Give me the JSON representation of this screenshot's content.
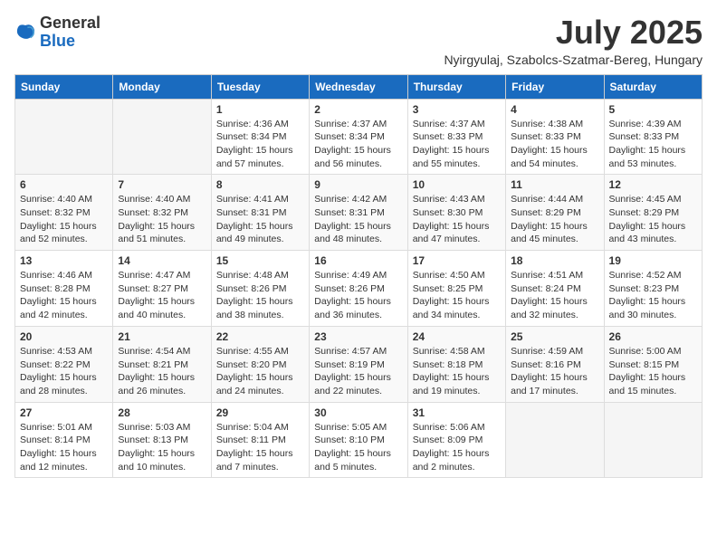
{
  "logo": {
    "general": "General",
    "blue": "Blue"
  },
  "header": {
    "month": "July 2025",
    "location": "Nyirgyulaj, Szabolcs-Szatmar-Bereg, Hungary"
  },
  "columns": [
    "Sunday",
    "Monday",
    "Tuesday",
    "Wednesday",
    "Thursday",
    "Friday",
    "Saturday"
  ],
  "weeks": [
    [
      {
        "day": "",
        "sunrise": "",
        "sunset": "",
        "daylight": ""
      },
      {
        "day": "",
        "sunrise": "",
        "sunset": "",
        "daylight": ""
      },
      {
        "day": "1",
        "sunrise": "Sunrise: 4:36 AM",
        "sunset": "Sunset: 8:34 PM",
        "daylight": "Daylight: 15 hours and 57 minutes."
      },
      {
        "day": "2",
        "sunrise": "Sunrise: 4:37 AM",
        "sunset": "Sunset: 8:34 PM",
        "daylight": "Daylight: 15 hours and 56 minutes."
      },
      {
        "day": "3",
        "sunrise": "Sunrise: 4:37 AM",
        "sunset": "Sunset: 8:33 PM",
        "daylight": "Daylight: 15 hours and 55 minutes."
      },
      {
        "day": "4",
        "sunrise": "Sunrise: 4:38 AM",
        "sunset": "Sunset: 8:33 PM",
        "daylight": "Daylight: 15 hours and 54 minutes."
      },
      {
        "day": "5",
        "sunrise": "Sunrise: 4:39 AM",
        "sunset": "Sunset: 8:33 PM",
        "daylight": "Daylight: 15 hours and 53 minutes."
      }
    ],
    [
      {
        "day": "6",
        "sunrise": "Sunrise: 4:40 AM",
        "sunset": "Sunset: 8:32 PM",
        "daylight": "Daylight: 15 hours and 52 minutes."
      },
      {
        "day": "7",
        "sunrise": "Sunrise: 4:40 AM",
        "sunset": "Sunset: 8:32 PM",
        "daylight": "Daylight: 15 hours and 51 minutes."
      },
      {
        "day": "8",
        "sunrise": "Sunrise: 4:41 AM",
        "sunset": "Sunset: 8:31 PM",
        "daylight": "Daylight: 15 hours and 49 minutes."
      },
      {
        "day": "9",
        "sunrise": "Sunrise: 4:42 AM",
        "sunset": "Sunset: 8:31 PM",
        "daylight": "Daylight: 15 hours and 48 minutes."
      },
      {
        "day": "10",
        "sunrise": "Sunrise: 4:43 AM",
        "sunset": "Sunset: 8:30 PM",
        "daylight": "Daylight: 15 hours and 47 minutes."
      },
      {
        "day": "11",
        "sunrise": "Sunrise: 4:44 AM",
        "sunset": "Sunset: 8:29 PM",
        "daylight": "Daylight: 15 hours and 45 minutes."
      },
      {
        "day": "12",
        "sunrise": "Sunrise: 4:45 AM",
        "sunset": "Sunset: 8:29 PM",
        "daylight": "Daylight: 15 hours and 43 minutes."
      }
    ],
    [
      {
        "day": "13",
        "sunrise": "Sunrise: 4:46 AM",
        "sunset": "Sunset: 8:28 PM",
        "daylight": "Daylight: 15 hours and 42 minutes."
      },
      {
        "day": "14",
        "sunrise": "Sunrise: 4:47 AM",
        "sunset": "Sunset: 8:27 PM",
        "daylight": "Daylight: 15 hours and 40 minutes."
      },
      {
        "day": "15",
        "sunrise": "Sunrise: 4:48 AM",
        "sunset": "Sunset: 8:26 PM",
        "daylight": "Daylight: 15 hours and 38 minutes."
      },
      {
        "day": "16",
        "sunrise": "Sunrise: 4:49 AM",
        "sunset": "Sunset: 8:26 PM",
        "daylight": "Daylight: 15 hours and 36 minutes."
      },
      {
        "day": "17",
        "sunrise": "Sunrise: 4:50 AM",
        "sunset": "Sunset: 8:25 PM",
        "daylight": "Daylight: 15 hours and 34 minutes."
      },
      {
        "day": "18",
        "sunrise": "Sunrise: 4:51 AM",
        "sunset": "Sunset: 8:24 PM",
        "daylight": "Daylight: 15 hours and 32 minutes."
      },
      {
        "day": "19",
        "sunrise": "Sunrise: 4:52 AM",
        "sunset": "Sunset: 8:23 PM",
        "daylight": "Daylight: 15 hours and 30 minutes."
      }
    ],
    [
      {
        "day": "20",
        "sunrise": "Sunrise: 4:53 AM",
        "sunset": "Sunset: 8:22 PM",
        "daylight": "Daylight: 15 hours and 28 minutes."
      },
      {
        "day": "21",
        "sunrise": "Sunrise: 4:54 AM",
        "sunset": "Sunset: 8:21 PM",
        "daylight": "Daylight: 15 hours and 26 minutes."
      },
      {
        "day": "22",
        "sunrise": "Sunrise: 4:55 AM",
        "sunset": "Sunset: 8:20 PM",
        "daylight": "Daylight: 15 hours and 24 minutes."
      },
      {
        "day": "23",
        "sunrise": "Sunrise: 4:57 AM",
        "sunset": "Sunset: 8:19 PM",
        "daylight": "Daylight: 15 hours and 22 minutes."
      },
      {
        "day": "24",
        "sunrise": "Sunrise: 4:58 AM",
        "sunset": "Sunset: 8:18 PM",
        "daylight": "Daylight: 15 hours and 19 minutes."
      },
      {
        "day": "25",
        "sunrise": "Sunrise: 4:59 AM",
        "sunset": "Sunset: 8:16 PM",
        "daylight": "Daylight: 15 hours and 17 minutes."
      },
      {
        "day": "26",
        "sunrise": "Sunrise: 5:00 AM",
        "sunset": "Sunset: 8:15 PM",
        "daylight": "Daylight: 15 hours and 15 minutes."
      }
    ],
    [
      {
        "day": "27",
        "sunrise": "Sunrise: 5:01 AM",
        "sunset": "Sunset: 8:14 PM",
        "daylight": "Daylight: 15 hours and 12 minutes."
      },
      {
        "day": "28",
        "sunrise": "Sunrise: 5:03 AM",
        "sunset": "Sunset: 8:13 PM",
        "daylight": "Daylight: 15 hours and 10 minutes."
      },
      {
        "day": "29",
        "sunrise": "Sunrise: 5:04 AM",
        "sunset": "Sunset: 8:11 PM",
        "daylight": "Daylight: 15 hours and 7 minutes."
      },
      {
        "day": "30",
        "sunrise": "Sunrise: 5:05 AM",
        "sunset": "Sunset: 8:10 PM",
        "daylight": "Daylight: 15 hours and 5 minutes."
      },
      {
        "day": "31",
        "sunrise": "Sunrise: 5:06 AM",
        "sunset": "Sunset: 8:09 PM",
        "daylight": "Daylight: 15 hours and 2 minutes."
      },
      {
        "day": "",
        "sunrise": "",
        "sunset": "",
        "daylight": ""
      },
      {
        "day": "",
        "sunrise": "",
        "sunset": "",
        "daylight": ""
      }
    ]
  ]
}
